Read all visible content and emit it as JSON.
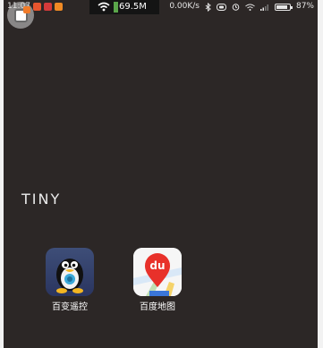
{
  "status_bar": {
    "time": "11:07",
    "net_speed": "69.5M",
    "rate": "0.00K/s",
    "battery": "87%",
    "battery_level": 0.87
  },
  "widget": {
    "text": "TINY"
  },
  "apps": [
    {
      "label": "百变遥控",
      "icon": "penguin-remote-icon"
    },
    {
      "label": "百度地图",
      "icon": "baidu-map-icon"
    }
  ],
  "colors": {
    "wallpaper": "#2c2726",
    "speed_bar": "#5aa54a",
    "overlay_badge": "#f07b2a",
    "map_pin": "#e8312a"
  }
}
